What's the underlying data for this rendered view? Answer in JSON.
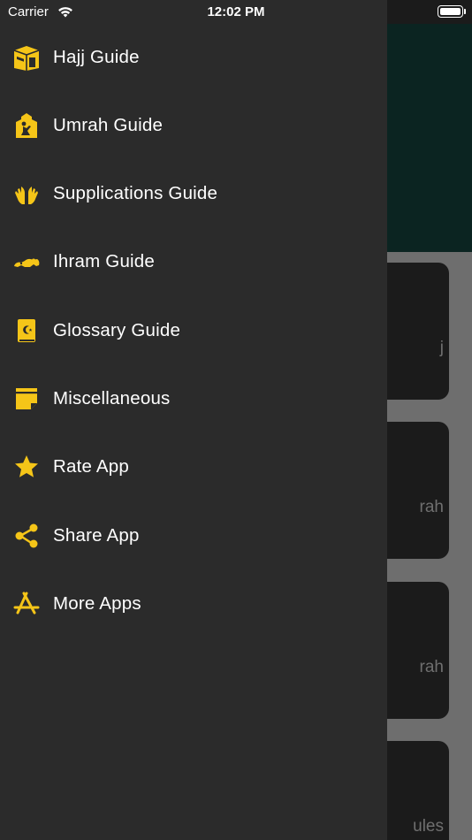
{
  "status_bar": {
    "carrier": "Carrier",
    "time": "12:02 PM"
  },
  "colors": {
    "accent": "#f5c518",
    "drawer_bg": "#2b2b2b",
    "overlay_bg": "#6e6e6e",
    "header_bg": "#0b2421"
  },
  "drawer": {
    "items": [
      {
        "label": "Hajj Guide",
        "icon": "kaaba-icon"
      },
      {
        "label": "Umrah Guide",
        "icon": "praying-person-icon"
      },
      {
        "label": "Supplications Guide",
        "icon": "praying-hands-icon"
      },
      {
        "label": "Ihram Guide",
        "icon": "ihram-icon"
      },
      {
        "label": "Glossary Guide",
        "icon": "quran-book-icon"
      },
      {
        "label": "Miscellaneous",
        "icon": "sticky-note-icon"
      },
      {
        "label": "Rate App",
        "icon": "star-icon"
      },
      {
        "label": "Share App",
        "icon": "share-icon"
      },
      {
        "label": "More Apps",
        "icon": "app-store-icon"
      }
    ]
  },
  "background_cards": [
    {
      "partial_label": "j"
    },
    {
      "partial_label": "rah"
    },
    {
      "partial_label": "rah"
    },
    {
      "partial_label": "ules"
    }
  ]
}
